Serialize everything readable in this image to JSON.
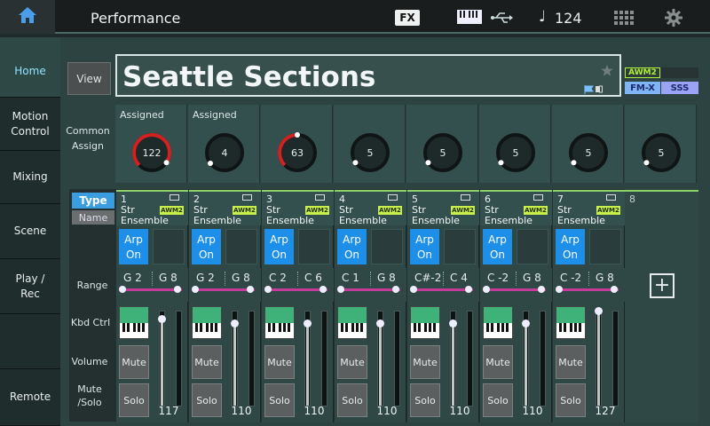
{
  "topbar": {
    "title": "Performance",
    "fx_label": "FX",
    "tempo_symbol": "♩",
    "tempo": "124"
  },
  "nav": {
    "items": [
      {
        "label": "Home"
      },
      {
        "label": "Motion Control"
      },
      {
        "label": "Mixing"
      },
      {
        "label": "Scene"
      },
      {
        "label": "Play / Rec"
      },
      {
        "label": "Remote"
      }
    ]
  },
  "view_label": "View",
  "performance_name": "Seattle Sections",
  "tags": {
    "awm2": "AWM2",
    "fm": "FM-X",
    "sss": "SSS"
  },
  "common_assign": {
    "label": "Common Assign",
    "knobs": [
      {
        "label": "Assigned",
        "value": "122",
        "fraction": 0.96,
        "highlight": true
      },
      {
        "label": "Assigned",
        "value": "4",
        "fraction": 0.03,
        "highlight": false
      },
      {
        "label": "",
        "value": "63",
        "fraction": 0.5,
        "highlight": true
      },
      {
        "label": "",
        "value": "5",
        "fraction": 0.04,
        "highlight": false
      },
      {
        "label": "",
        "value": "5",
        "fraction": 0.04,
        "highlight": false
      },
      {
        "label": "",
        "value": "5",
        "fraction": 0.04,
        "highlight": false
      },
      {
        "label": "",
        "value": "5",
        "fraction": 0.04,
        "highlight": false
      },
      {
        "label": "",
        "value": "5",
        "fraction": 0.04,
        "highlight": false
      }
    ]
  },
  "row_labels": {
    "type": "Type",
    "name": "Name",
    "range": "Range",
    "kbd_ctrl": "Kbd Ctrl",
    "volume": "Volume",
    "mute_solo": "Mute /Solo"
  },
  "parts": [
    {
      "num": "1",
      "line1": "Str",
      "line2": "Ensemble",
      "arp": "Arp On",
      "range_lo": "G 2",
      "range_hi": "G 8",
      "range_lo_frac": 0.05,
      "range_hi_frac": 0.95,
      "mute": "Mute",
      "solo": "Solo",
      "volume": "117",
      "vol_frac": 0.92
    },
    {
      "num": "2",
      "line1": "Str",
      "line2": "Ensemble",
      "arp": "Arp On",
      "range_lo": "G 2",
      "range_hi": "G 8",
      "range_lo_frac": 0.05,
      "range_hi_frac": 0.95,
      "mute": "Mute",
      "solo": "Solo",
      "volume": "110",
      "vol_frac": 0.87
    },
    {
      "num": "3",
      "line1": "Str",
      "line2": "Ensemble",
      "arp": "Arp On",
      "range_lo": "C 2",
      "range_hi": "C 6",
      "range_lo_frac": 0.05,
      "range_hi_frac": 0.95,
      "mute": "Mute",
      "solo": "Solo",
      "volume": "110",
      "vol_frac": 0.87
    },
    {
      "num": "4",
      "line1": "Str",
      "line2": "Ensemble",
      "arp": "Arp On",
      "range_lo": "C 1",
      "range_hi": "G 8",
      "range_lo_frac": 0.05,
      "range_hi_frac": 0.95,
      "mute": "Mute",
      "solo": "Solo",
      "volume": "110",
      "vol_frac": 0.87
    },
    {
      "num": "5",
      "line1": "Str",
      "line2": "Ensemble",
      "arp": "Arp On",
      "range_lo": "C#-2",
      "range_hi": "C 4",
      "range_lo_frac": 0.05,
      "range_hi_frac": 0.95,
      "mute": "Mute",
      "solo": "Solo",
      "volume": "110",
      "vol_frac": 0.87
    },
    {
      "num": "6",
      "line1": "Str",
      "line2": "Ensemble",
      "arp": "Arp On",
      "range_lo": "C -2",
      "range_hi": "G 8",
      "range_lo_frac": 0.05,
      "range_hi_frac": 0.95,
      "mute": "Mute",
      "solo": "Solo",
      "volume": "110",
      "vol_frac": 0.87
    },
    {
      "num": "7",
      "line1": "Str",
      "line2": "Ensemble",
      "arp": "Arp On",
      "range_lo": "C -2",
      "range_hi": "G 8",
      "range_lo_frac": 0.05,
      "range_hi_frac": 0.95,
      "mute": "Mute",
      "solo": "Solo",
      "volume": "127",
      "vol_frac": 1.0
    }
  ],
  "part8_num": "8",
  "add_symbol": "+",
  "colors": {
    "accent_blue": "#1d8fe8",
    "awm2_green": "#c8f04a",
    "knob_red": "#d32020",
    "range_bar": "#c53b9a"
  }
}
